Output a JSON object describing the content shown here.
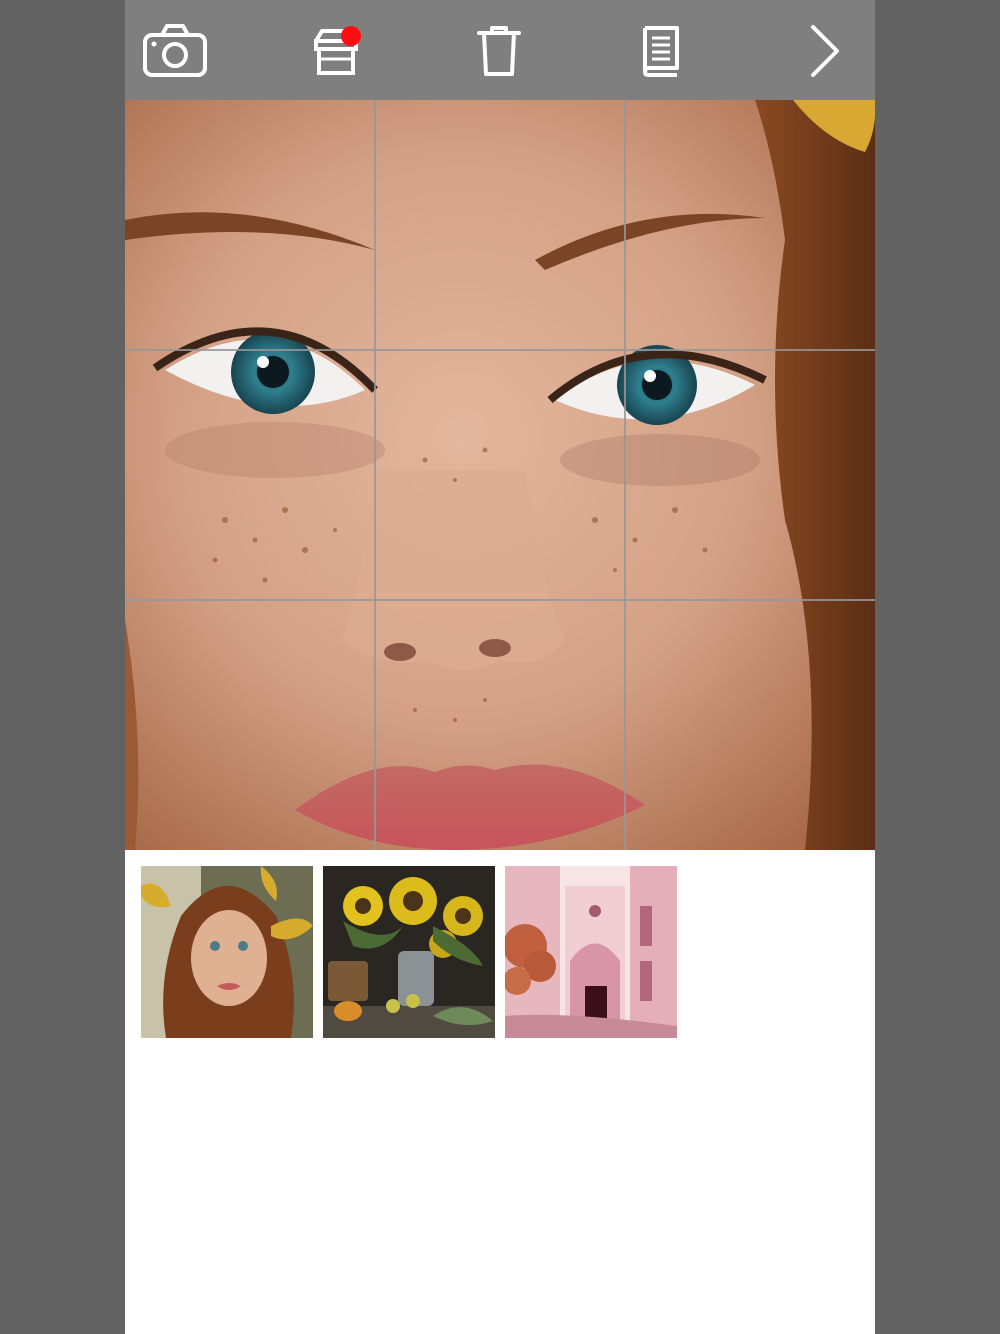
{
  "toolbar": {
    "icons": [
      "camera-icon",
      "store-icon",
      "trash-icon",
      "book-icon",
      "chevron-right-icon"
    ],
    "store_has_notification": true
  },
  "canvas": {
    "image": "freckled-face-closeup",
    "grid": "3x3"
  },
  "thumbnails": [
    {
      "image": "girl-portrait"
    },
    {
      "image": "sunflower-still-life"
    },
    {
      "image": "pink-alley"
    }
  ],
  "colors": {
    "toolbar_bg": "#7f7f7f",
    "icon": "#ffffff",
    "badge": "#ff0d12",
    "outer_bg": "#626262",
    "panel_bg": "#ffffff"
  }
}
